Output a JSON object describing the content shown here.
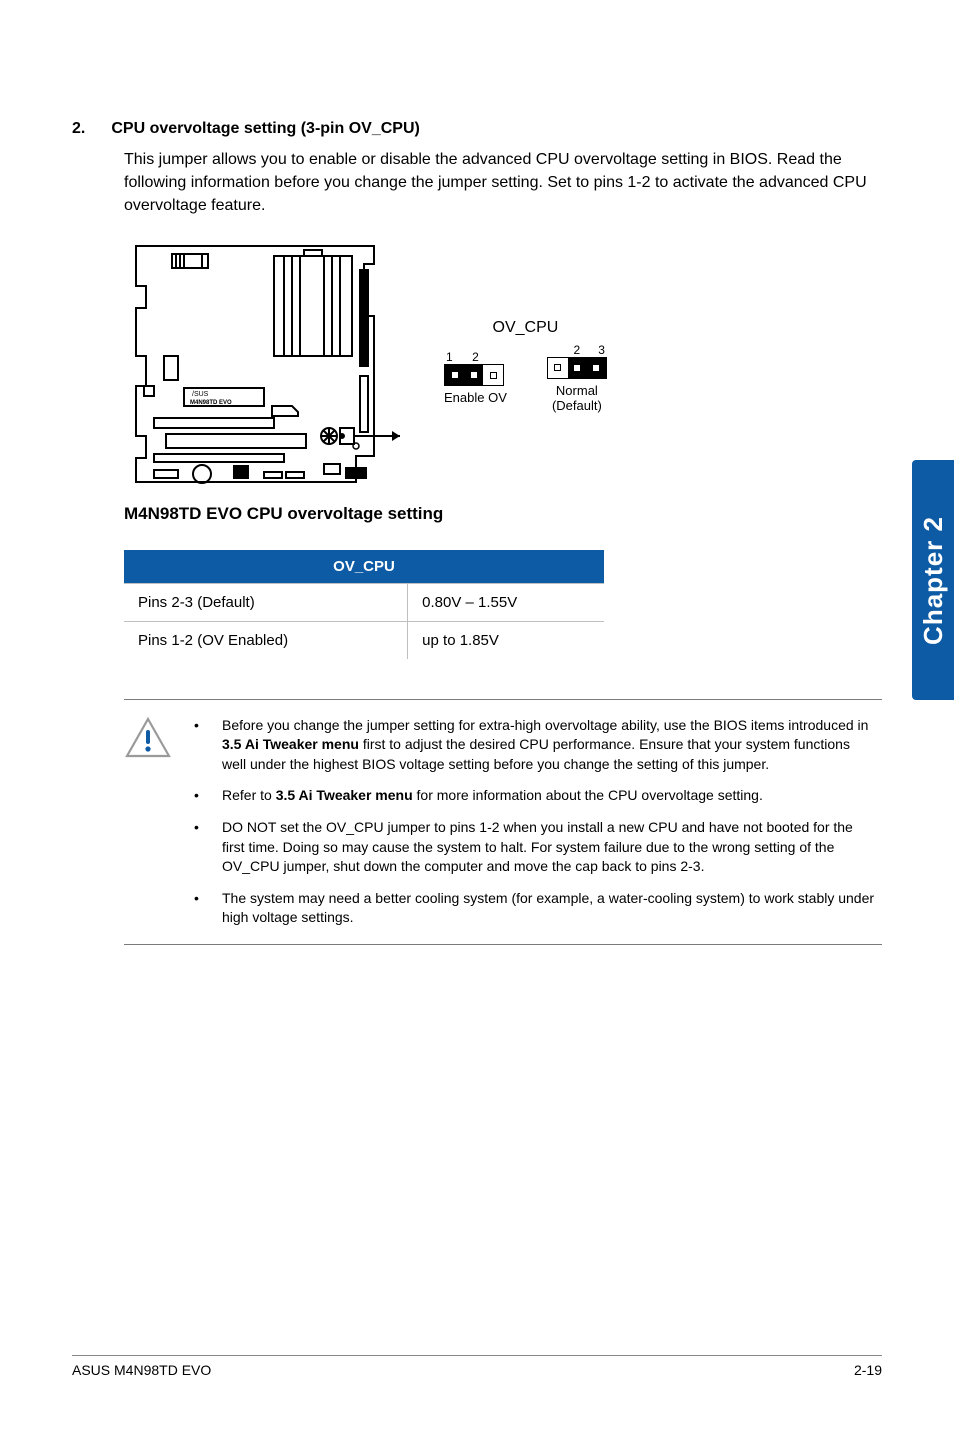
{
  "section": {
    "number": "2.",
    "title": "CPU overvoltage setting (3-pin OV_CPU)",
    "body": "This jumper allows you to enable or disable the advanced CPU overvoltage setting in BIOS. Read the following information before you change the jumper setting. Set to pins 1-2 to activate the advanced CPU overvoltage feature."
  },
  "diagram": {
    "jumper_name": "OV_CPU",
    "left": {
      "pins": [
        "1",
        "2"
      ],
      "label": "Enable OV"
    },
    "right": {
      "pins": [
        "2",
        "3"
      ],
      "label": "Normal",
      "sublabel": "(Default)"
    },
    "caption": "M4N98TD EVO CPU overvoltage setting",
    "board_label_top": "/SUS",
    "board_label_bottom": "M4N98TD EVO"
  },
  "table": {
    "header": "OV_CPU",
    "rows": [
      {
        "c1": "Pins 2-3 (Default)",
        "c2": "0.80V – 1.55V"
      },
      {
        "c1": "Pins 1-2 (OV Enabled)",
        "c2": "up to 1.85V"
      }
    ]
  },
  "callout": {
    "items": [
      {
        "pre": "Before you change the jumper setting for extra-high overvoltage ability, use the BIOS items introduced in ",
        "bold": "3.5 Ai Tweaker menu",
        "post": " first to adjust the desired CPU performance. Ensure that your system functions well under the highest BIOS voltage setting before you change the setting of this jumper."
      },
      {
        "pre": "Refer to ",
        "bold": "3.5 Ai Tweaker menu",
        "post": " for more information about the CPU overvoltage setting."
      },
      {
        "pre": "DO NOT set the OV_CPU jumper to pins 1-2 when you install a new CPU and have not booted for the first time. Doing so may cause the system to halt. For system failure due to the wrong setting of the OV_CPU jumper, shut down the computer and move the cap back to pins 2-3.",
        "bold": "",
        "post": ""
      },
      {
        "pre": "The system may need a better cooling system (for example, a water-cooling system) to work stably under high voltage settings.",
        "bold": "",
        "post": ""
      }
    ]
  },
  "side_tab": "Chapter 2",
  "footer": {
    "left": "ASUS M4N98TD EVO",
    "right": "2-19"
  }
}
